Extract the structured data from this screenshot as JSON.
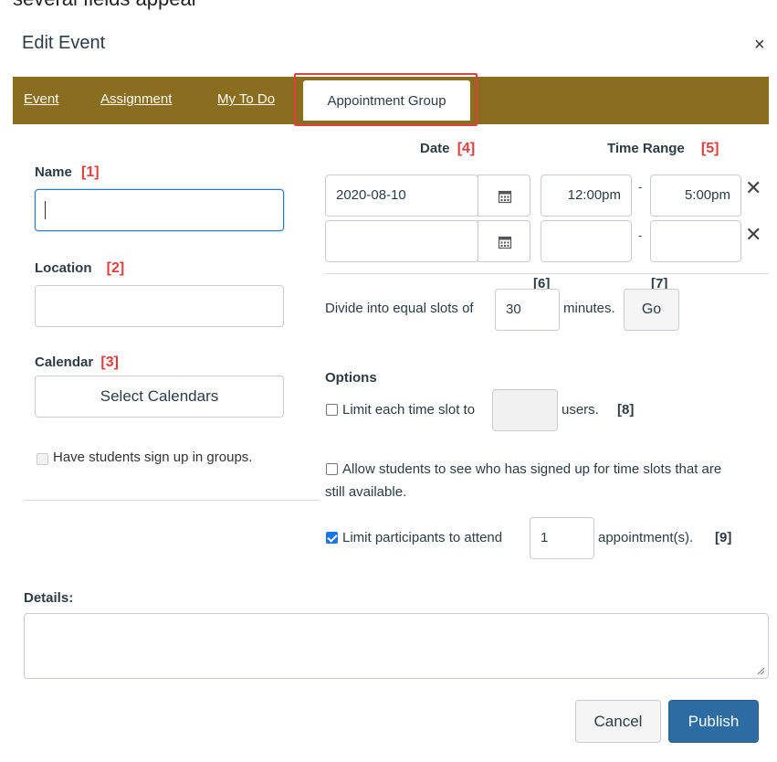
{
  "header": {
    "top_cut_text": "several fields appear",
    "title": "Edit Event",
    "close_symbol": "×"
  },
  "tabs": {
    "items": [
      "Event",
      "Assignment",
      "My To Do",
      "Appointment Group"
    ],
    "active": "Appointment Group"
  },
  "form": {
    "name_label": "Name",
    "name_ann": "[1]",
    "location_label": "Location",
    "location_ann": "[2]",
    "calendar_label": "Calendar",
    "calendar_ann": "[3]",
    "select_calendars": "Select Calendars",
    "groups_checkbox_label": "Have students sign up in groups."
  },
  "schedule": {
    "date_header": "Date",
    "date_ann": "[4]",
    "time_range_header": "Time Range",
    "time_range_ann": "[5]",
    "rows": [
      {
        "date": "2020-08-10",
        "start": "12:00pm",
        "end": "5:00pm"
      },
      {
        "date": "",
        "start": "",
        "end": ""
      }
    ],
    "range_separator": "-",
    "divide_label": "Divide into equal slots of",
    "slot_value": "30",
    "minutes_label": "minutes.",
    "slots_ann": "[6]",
    "go_label": "Go",
    "go_ann": "[7]"
  },
  "options": {
    "heading": "Options",
    "limit_slot_label": "Limit each time slot to",
    "users_label": "users.",
    "limit_slot_ann": "[8]",
    "limit_slot_checked": false,
    "allow_see_label_line1": "Allow students to see who has signed up for time slots that are",
    "allow_see_label_line2": "still available.",
    "allow_see_checked": false,
    "limit_participants_label": "Limit participants to attend",
    "limit_participants_value": "1",
    "appointments_label": "appointment(s).",
    "limit_participants_ann": "[9]",
    "limit_participants_checked": true
  },
  "details": {
    "label": "Details:",
    "value": ""
  },
  "footer": {
    "cancel_label": "Cancel",
    "publish_label": "Publish"
  },
  "colors": {
    "tab_bar": "#8a6d1e",
    "annotation_red": "#e0403b",
    "publish_blue": "#2d6ca2",
    "focus_blue": "#2b7abc"
  }
}
